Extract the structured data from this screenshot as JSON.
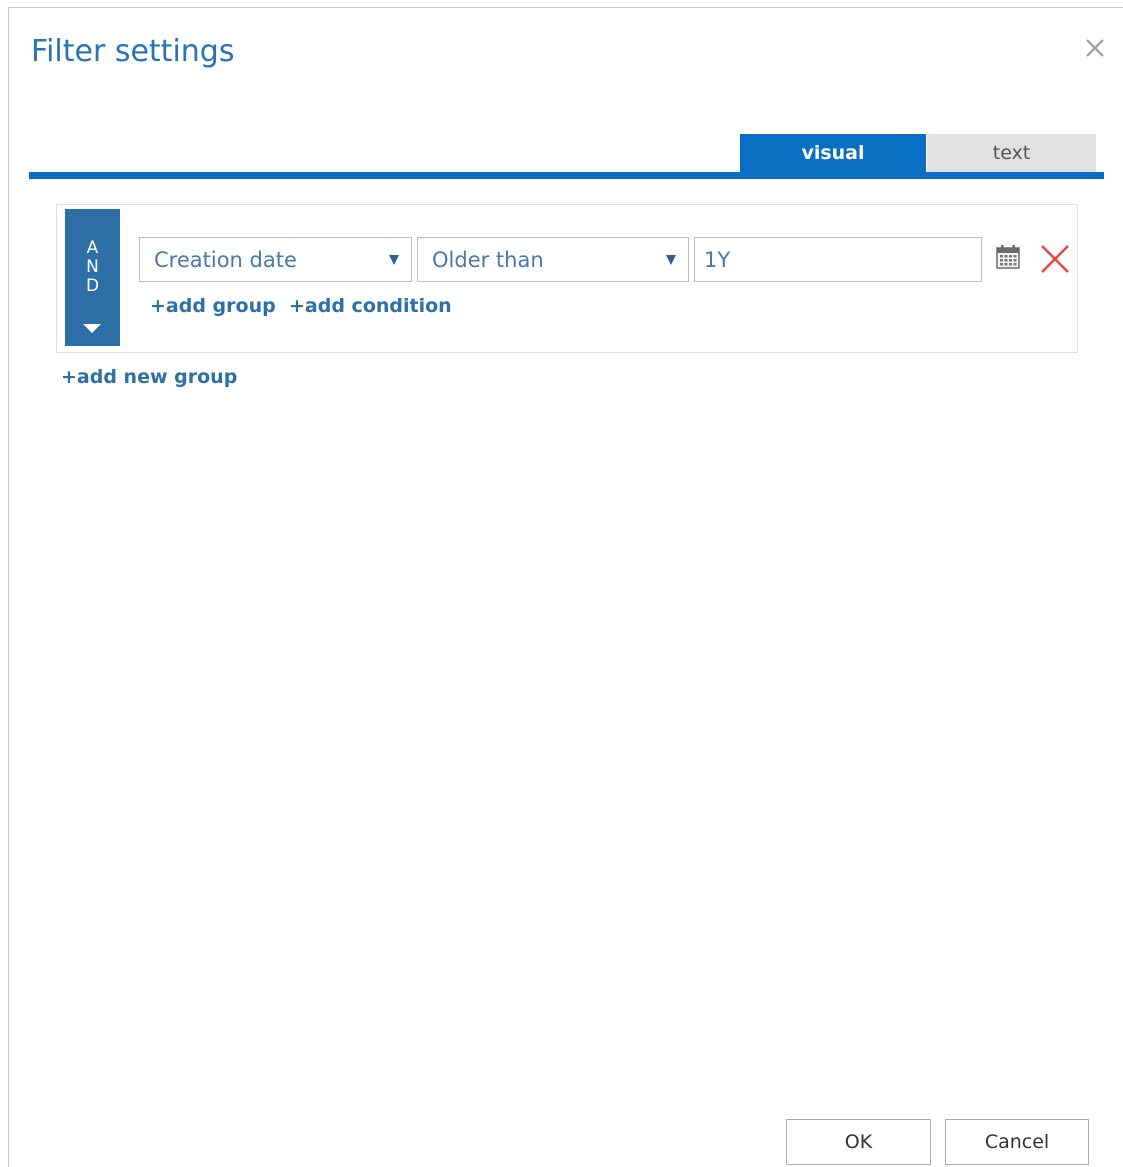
{
  "dialog": {
    "title": "Filter settings"
  },
  "tabs": [
    {
      "label": "visual",
      "active": true
    },
    {
      "label": "text",
      "active": false
    }
  ],
  "group": {
    "operator_letters": [
      "A",
      "N",
      "D"
    ],
    "condition": {
      "field": "Creation date",
      "operator": "Older than",
      "value": "1Y"
    },
    "add_group_label": "+add group",
    "add_condition_label": "+add condition"
  },
  "add_new_group_label": "+add new group",
  "footer": {
    "ok_label": "OK",
    "cancel_label": "Cancel"
  },
  "icons": {
    "close": "close-icon",
    "calendar": "calendar-icon",
    "remove": "remove-condition-icon",
    "dropdown": "chevron-down-icon"
  },
  "colors": {
    "accent": "#0a6fc2",
    "and_block": "#2f6fa8",
    "remove": "#e84545"
  }
}
